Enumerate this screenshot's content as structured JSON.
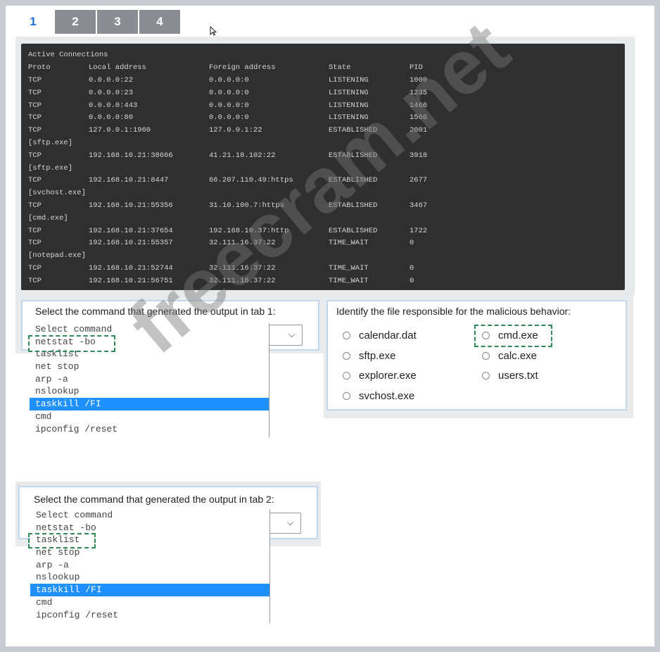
{
  "tabs": [
    {
      "label": "1",
      "active": true
    },
    {
      "label": "2",
      "active": false
    },
    {
      "label": "3",
      "active": false
    },
    {
      "label": "4",
      "active": false
    }
  ],
  "terminal": {
    "heading": "Active Connections",
    "columns": [
      "Proto",
      "Local address",
      "Foreign address",
      "State",
      "PID"
    ],
    "rows": [
      {
        "type": "conn",
        "proto": "TCP",
        "local": "0.0.0.0:22",
        "foreign": "0.0.0.0:0",
        "state": "LISTENING",
        "pid": "1000"
      },
      {
        "type": "conn",
        "proto": "TCP",
        "local": "0.0.0.0:23",
        "foreign": "0.0.0.0:0",
        "state": "LISTENING",
        "pid": "1235"
      },
      {
        "type": "conn",
        "proto": "TCP",
        "local": "0.0.0.0:443",
        "foreign": "0.0.0.0:0",
        "state": "LISTENING",
        "pid": "1466"
      },
      {
        "type": "conn",
        "proto": "TCP",
        "local": "0.0.0.0:80",
        "foreign": "0.0.0.0:0",
        "state": "LISTENING",
        "pid": "1566"
      },
      {
        "type": "conn",
        "proto": "TCP",
        "local": "127.0.0.1:1960",
        "foreign": "127.0.0.1:22",
        "state": "ESTABLISHED",
        "pid": "2001"
      },
      {
        "type": "proc",
        "name": "[sftp.exe]"
      },
      {
        "type": "conn",
        "proto": "TCP",
        "local": "192.168.10.21:38666",
        "foreign": "41.21.18.102:22",
        "state": "ESTABLISHED",
        "pid": "3918"
      },
      {
        "type": "proc",
        "name": "[sftp.exe]"
      },
      {
        "type": "conn",
        "proto": "TCP",
        "local": "192.168.10.21:8447",
        "foreign": "66.207.110.49:https",
        "state": "ESTABLISHED",
        "pid": "2677"
      },
      {
        "type": "proc",
        "name": "[svchost.exe]"
      },
      {
        "type": "conn",
        "proto": "TCP",
        "local": "192.168.10.21:55356",
        "foreign": "31.10.100.7:https",
        "state": "ESTABLISHED",
        "pid": "3467"
      },
      {
        "type": "proc",
        "name": "[cmd.exe]"
      },
      {
        "type": "conn",
        "proto": "TCP",
        "local": "192.168.10.21:37654",
        "foreign": "192.168.10.37:http",
        "state": "ESTABLISHED",
        "pid": "1722"
      },
      {
        "type": "conn",
        "proto": "TCP",
        "local": "192.168.10.21:55357",
        "foreign": "32.111.16.37:22",
        "state": "TIME_WAIT",
        "pid": "0"
      },
      {
        "type": "proc",
        "name": "[notepad.exe]"
      },
      {
        "type": "conn",
        "proto": "TCP",
        "local": "192.168.10.21:52744",
        "foreign": "32.111.16.37:22",
        "state": "TIME_WAIT",
        "pid": "0"
      },
      {
        "type": "conn",
        "proto": "TCP",
        "local": "192.168.10.21:56751",
        "foreign": "32.111.16.37:22",
        "state": "TIME_WAIT",
        "pid": "0"
      }
    ]
  },
  "question1": {
    "prompt": "Select the command that generated the output in tab 1:",
    "options": [
      "Select command",
      "netstat -bo",
      "tasklist",
      "net stop",
      "arp -a",
      "nslookup",
      "taskkill /FI",
      "cmd",
      "ipconfig /reset"
    ],
    "highlighted": "taskkill /FI",
    "marked": "netstat -bo"
  },
  "question2": {
    "prompt": "Identify the file responsible for the malicious behavior:",
    "options": [
      "calendar.dat",
      "cmd.exe",
      "sftp.exe",
      "calc.exe",
      "explorer.exe",
      "users.txt",
      "svchost.exe"
    ],
    "marked": "cmd.exe"
  },
  "question3": {
    "prompt": "Select the command that generated the output in tab 2:",
    "options": [
      "Select command",
      "netstat -bo",
      "tasklist",
      "net stop",
      "arp -a",
      "nslookup",
      "taskkill /FI",
      "cmd",
      "ipconfig /reset"
    ],
    "highlighted": "taskkill /FI",
    "marked": "tasklist"
  },
  "watermark": "freecram.net",
  "colors": {
    "accent": "#1a6fd6",
    "highlight": "#1e90ff",
    "answer_marker": "#2e8b57",
    "terminal_bg": "#2f2f2f"
  }
}
